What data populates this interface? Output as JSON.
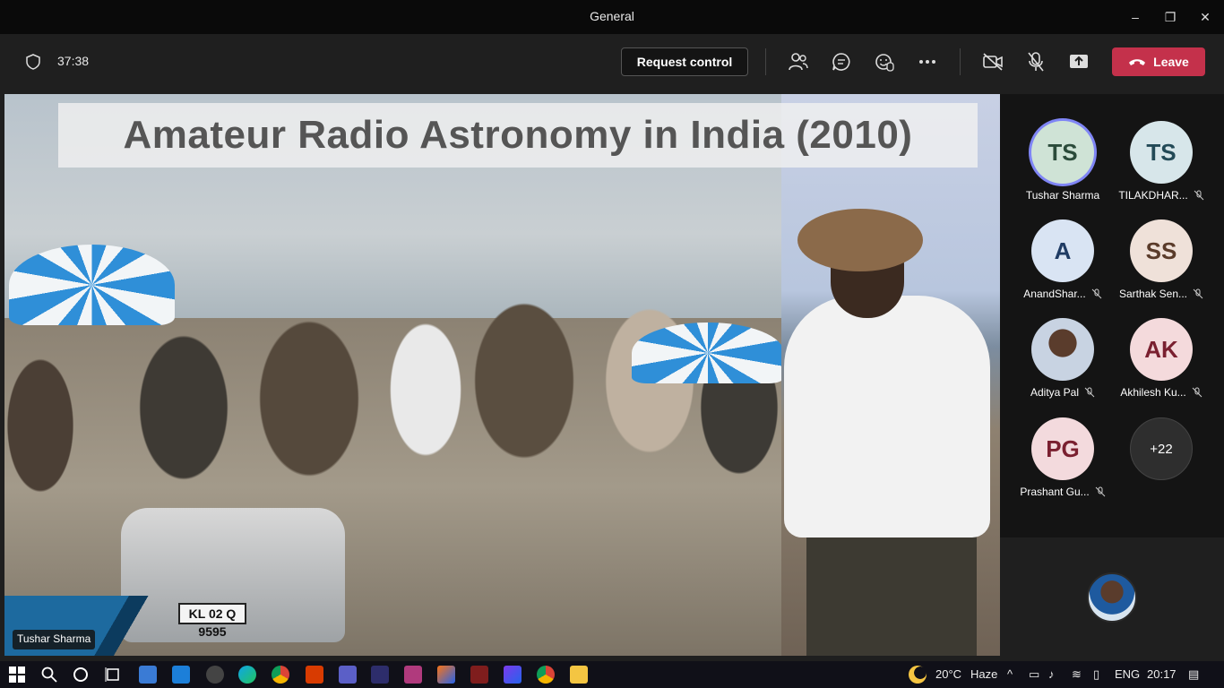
{
  "window": {
    "title": "General",
    "controls": {
      "minimize": "–",
      "restore": "❐",
      "close": "✕"
    }
  },
  "toolbar": {
    "timer": "37:38",
    "request_control": "Request control",
    "leave": "Leave"
  },
  "slide": {
    "title": "Amateur Radio Astronomy in India (2010)",
    "plate": "KL 02 Q\n9595",
    "presenter_label": "Tushar Sharma"
  },
  "participants": [
    {
      "initials": "TS",
      "name": "Tushar Sharma",
      "muted": false,
      "bg": "#cfe3d6",
      "fg": "#2b4b3a",
      "active": true
    },
    {
      "initials": "TS",
      "name": "TILAKDHAR...",
      "muted": true,
      "bg": "#d7e6ea",
      "fg": "#234a57",
      "active": false
    },
    {
      "initials": "A",
      "name": "AnandShar...",
      "muted": true,
      "bg": "#d9e4f3",
      "fg": "#1f3b63",
      "active": false
    },
    {
      "initials": "SS",
      "name": "Sarthak Sen...",
      "muted": true,
      "bg": "#efe1d9",
      "fg": "#5a3b2a",
      "active": false
    },
    {
      "initials": "",
      "name": "Aditya Pal",
      "muted": true,
      "bg": "#c8d3e2",
      "fg": "#1f3b63",
      "active": false
    },
    {
      "initials": "AK",
      "name": "Akhilesh Ku...",
      "muted": true,
      "bg": "#f4dadc",
      "fg": "#7a2030",
      "active": false
    },
    {
      "initials": "PG",
      "name": "Prashant Gu...",
      "muted": true,
      "bg": "#f3dadd",
      "fg": "#7a2030",
      "active": false
    }
  ],
  "more_participants": "+22",
  "taskbar": {
    "weather": "20°C",
    "weather_desc": "Haze",
    "language": "ENG",
    "time": "20:17"
  },
  "colors": {
    "leave": "#c4314b",
    "accent": "#7f85f5",
    "taskbar": "#101018"
  }
}
